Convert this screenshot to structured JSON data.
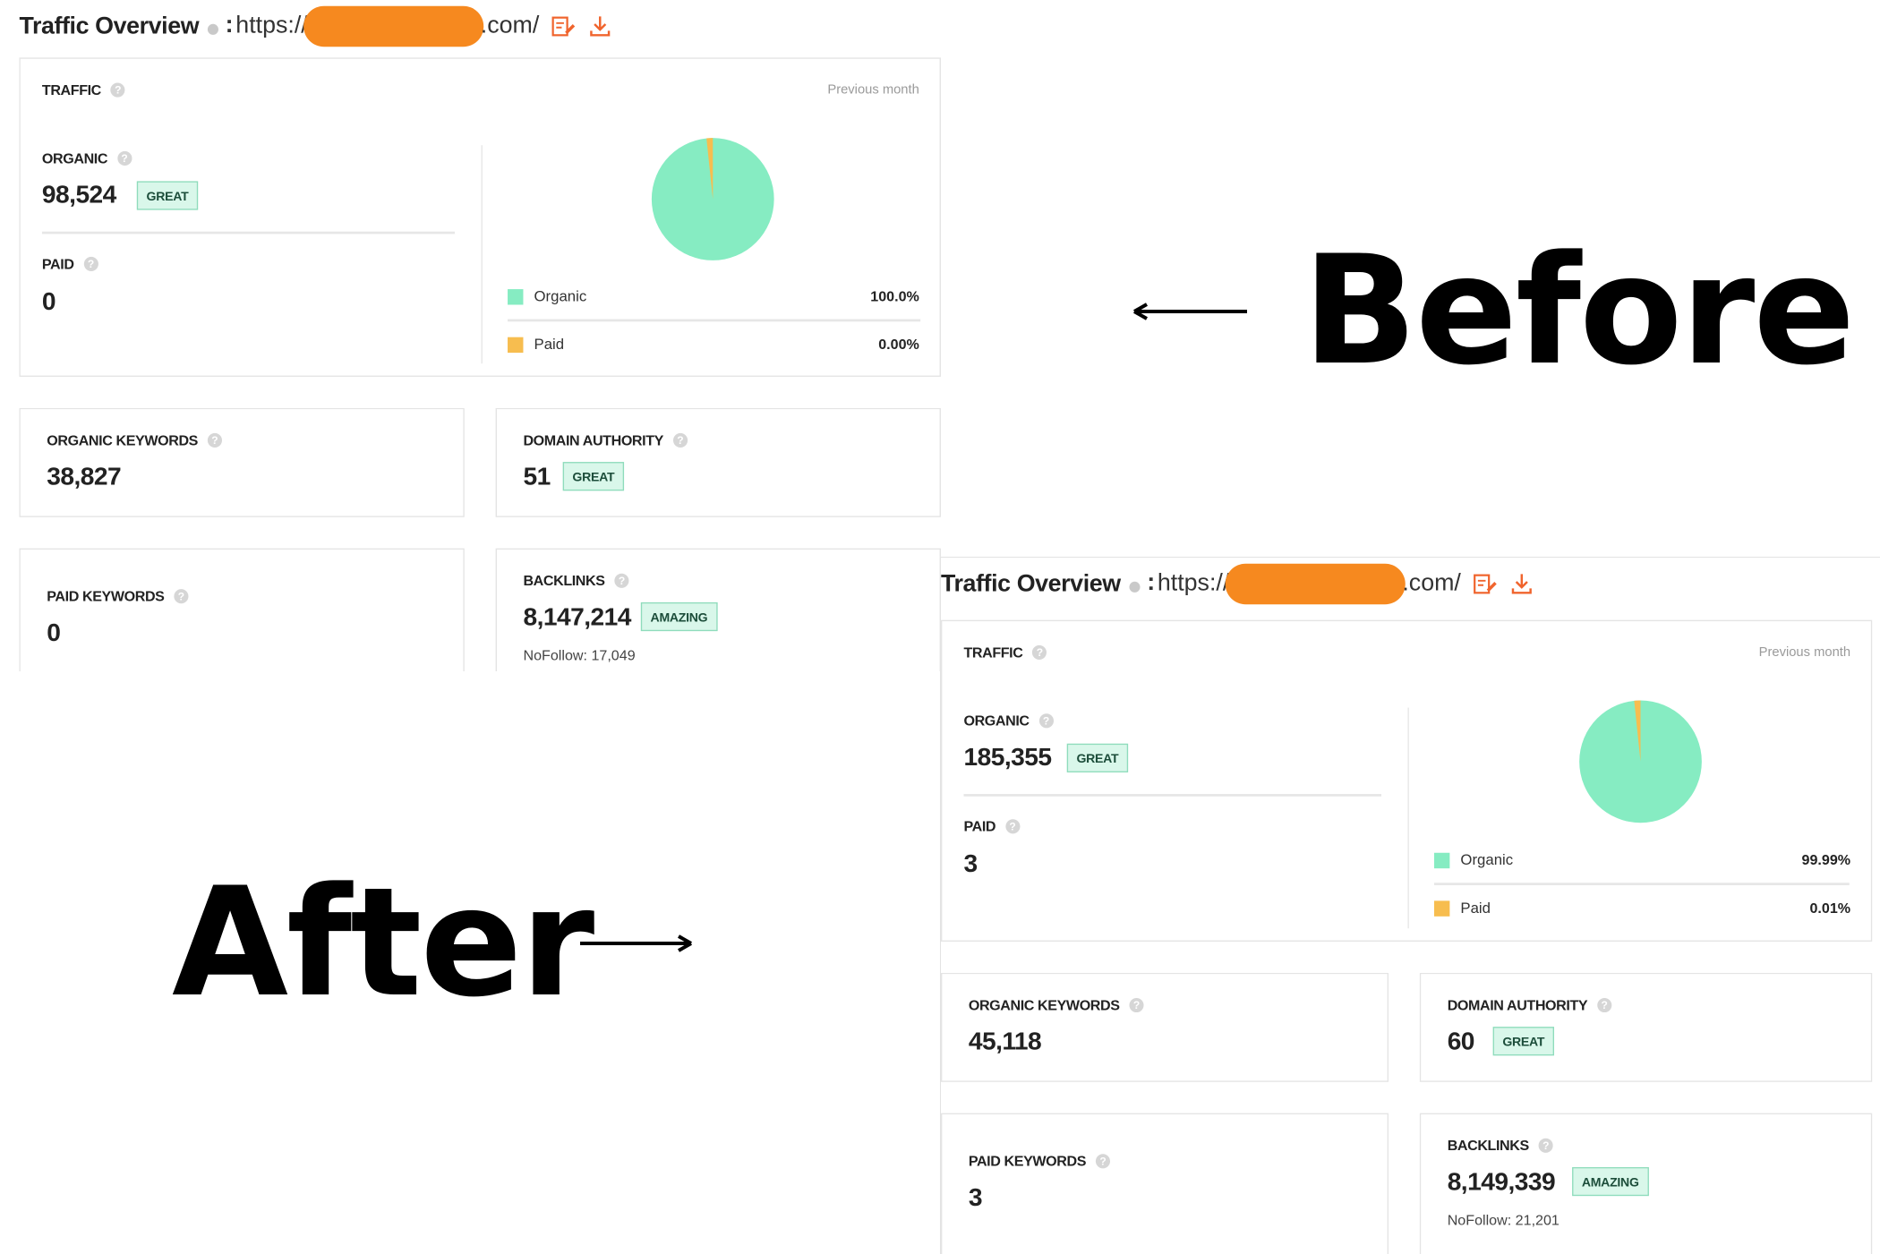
{
  "before": {
    "header": {
      "title": "Traffic Overview",
      "url_prefix": "https://",
      "url_suffix": ".com/",
      "separator": ":"
    },
    "traffic": {
      "label": "TRAFFIC",
      "period": "Previous month",
      "organic_label": "ORGANIC",
      "organic_value": "98,524",
      "organic_badge": "GREAT",
      "paid_label": "PAID",
      "paid_value": "0",
      "legend": [
        {
          "name": "Organic",
          "pct": "100.0%",
          "color": "#86ecc2"
        },
        {
          "name": "Paid",
          "pct": "0.00%",
          "color": "#f7bd4f"
        }
      ]
    },
    "organic_keywords": {
      "label": "ORGANIC KEYWORDS",
      "value": "38,827"
    },
    "domain_authority": {
      "label": "DOMAIN AUTHORITY",
      "value": "51",
      "badge": "GREAT"
    },
    "paid_keywords": {
      "label": "PAID KEYWORDS",
      "value": "0"
    },
    "backlinks": {
      "label": "BACKLINKS",
      "value": "8,147,214",
      "badge": "AMAZING",
      "nofollow": "NoFollow: 17,049"
    }
  },
  "after": {
    "header": {
      "title": "Traffic Overview",
      "url_prefix": "https://",
      "url_suffix": ".com/",
      "separator": ":"
    },
    "traffic": {
      "label": "TRAFFIC",
      "period": "Previous month",
      "organic_label": "ORGANIC",
      "organic_value": "185,355",
      "organic_badge": "GREAT",
      "paid_label": "PAID",
      "paid_value": "3",
      "legend": [
        {
          "name": "Organic",
          "pct": "99.99%",
          "color": "#86ecc2"
        },
        {
          "name": "Paid",
          "pct": "0.01%",
          "color": "#f7bd4f"
        }
      ]
    },
    "organic_keywords": {
      "label": "ORGANIC KEYWORDS",
      "value": "45,118"
    },
    "domain_authority": {
      "label": "DOMAIN AUTHORITY",
      "value": "60",
      "badge": "GREAT"
    },
    "paid_keywords": {
      "label": "PAID KEYWORDS",
      "value": "3"
    },
    "backlinks": {
      "label": "BACKLINKS",
      "value": "8,149,339",
      "badge": "AMAZING",
      "nofollow": "NoFollow: 21,201"
    }
  },
  "annotations": {
    "before_label": "Before",
    "after_label": "After"
  },
  "colors": {
    "organic": "#86ecc2",
    "paid": "#f7bd4f",
    "redaction": "#f6891f",
    "icon_accent": "#f0642d"
  }
}
